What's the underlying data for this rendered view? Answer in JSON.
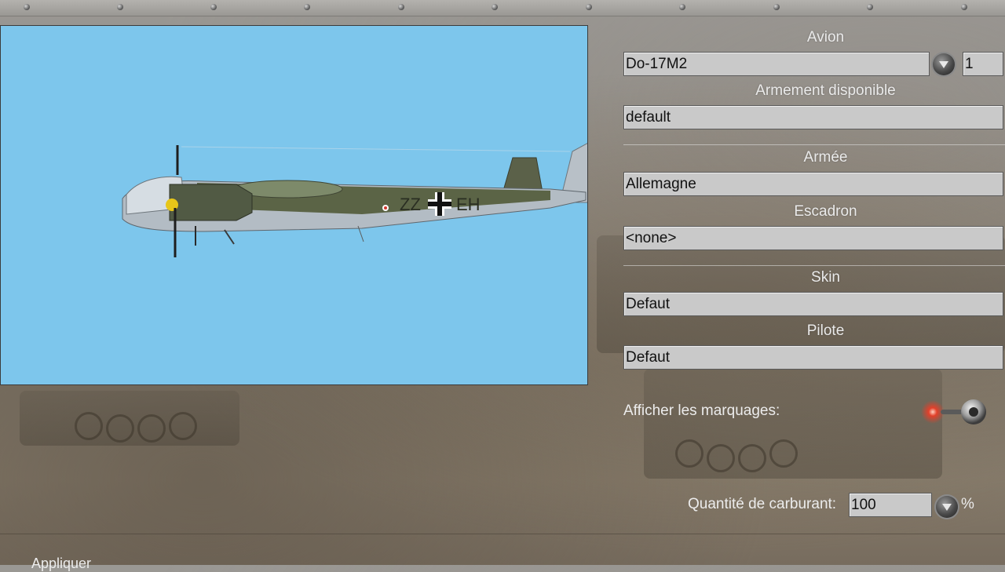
{
  "preview": {
    "aircraft_fuselage_code": "ZZ",
    "aircraft_tail_code": "EH"
  },
  "form": {
    "avion_label": "Avion",
    "avion_value": "Do-17M2",
    "avion_count": "1",
    "armement_label": "Armement disponible",
    "armement_value": "default",
    "armee_label": "Armée",
    "armee_value": "Allemagne",
    "escadron_label": "Escadron",
    "escadron_value": "<none>",
    "skin_label": "Skin",
    "skin_value": "Defaut",
    "pilote_label": "Pilote",
    "pilote_value": "Defaut",
    "marquages_label": "Afficher les marquages:",
    "marquages_enabled": false,
    "fuel_label": "Quantité de carburant:",
    "fuel_value": "100",
    "fuel_unit": "%"
  },
  "footer": {
    "apply_label": "Appliquer"
  },
  "colors": {
    "sky": "#7dc6ec",
    "field_bg": "#c9c9c9",
    "label": "#eaeaea",
    "toggle_light": "#e2402a"
  },
  "icons": {
    "dropdown": "chevron-down-icon",
    "toggle": "toggle-icon"
  }
}
